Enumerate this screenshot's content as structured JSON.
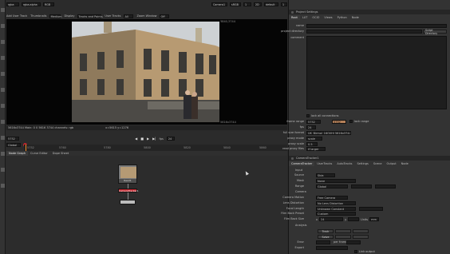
{
  "viewer": {
    "top_left": {
      "channel": "rgba",
      "layer": "rgba.alpha",
      "fmt": "RGB"
    },
    "top_right": {
      "camera": "Camera1",
      "lut": "sRGB",
      "gain": "1",
      "view": "default",
      "gamma": "1",
      "ratio": "2D",
      "zoom": "1:1"
    },
    "row2": {
      "add_user_track": "Add User Track",
      "thumbnail_label": "Thumbnails",
      "thumbnail_value": "Medium",
      "display_label": "Display",
      "display_value": "Tracks and Points",
      "user_tracks_label": "User Tracks",
      "user_tracks_value": "All",
      "zoom_label": "Zoom Window",
      "zoom_value": "Off"
    },
    "image_corner_top": "3840,3744",
    "info_bar": "5616x3744 Main: 0 0 5616 3744  channels: rgb",
    "coords": "x=5615 y=1276",
    "corner_label": "5616x3744"
  },
  "timeline": {
    "frame": "5752",
    "fps_label": "fps",
    "fps": "24",
    "mode": "Global",
    "start": "5752",
    "ticks": [
      "5752",
      "5760",
      "5780",
      "5800",
      "5820",
      "5840",
      "5860",
      "5870"
    ],
    "end": "5870"
  },
  "node_graph": {
    "tabs": [
      "Node Graph",
      "Curve Editor",
      "Dope Sheet"
    ],
    "read_label": "Read1",
    "tracker_label": "CameraTracker1"
  },
  "project_settings": {
    "title": "Project Settings",
    "tabs": [
      "Root",
      "LUT",
      "OCIO",
      "Views",
      "Python",
      "Node"
    ],
    "fields": {
      "name": "name",
      "project_directory": "project directory",
      "comment": "comment",
      "lock": "lock all connections",
      "frame_range": "frame range",
      "range_start": "5752",
      "range_end": "5752",
      "lock_range": "lock range",
      "fps": "fps",
      "fps_value": "24",
      "full_size_format": "full size format",
      "format_value": "UK_Birmol_16OVHI 5616x3744 2048x1556",
      "proxy_mode": "proxy mode",
      "proxy_mode_value": "scale",
      "proxy_scale": "proxy scale",
      "proxy_scale_value": "0.5",
      "read_proxy": "read proxy files",
      "read_proxy_value": "if larger",
      "script_directory": "Script Directory"
    }
  },
  "camera_tracker": {
    "title": "CameraTracker1",
    "tabs": [
      "CameraTracker",
      "UserTracks",
      "AutoTracks",
      "Settings",
      "Scene",
      "Output",
      "Node"
    ],
    "input_header": "Input",
    "source": "Source",
    "source_value": "Sbla",
    "mask": "Mask",
    "mask_value": "None",
    "range": "Range",
    "range_value": "Global",
    "camera_header": "Camera",
    "camera_motion": "Camera Motion",
    "camera_motion_value": "Free Camera",
    "lens_distortion": "Lens Distortion",
    "lens_distortion_value": "No Lens Distortion",
    "focal_length": "Focal Length",
    "focal_length_value": "Unknown Constant",
    "film_back_preset": "Film Back Preset",
    "film_back_value": "Custom",
    "film_back_size": "Film Back Size",
    "fb_x": "x",
    "fb_x_value": "24",
    "fb_y": "y",
    "fb_units": "Units",
    "fb_units_value": "mm",
    "analysis_header": "Analysis",
    "track": "Track",
    "solve": "Solve",
    "error": "Error",
    "per_frame": "per frame",
    "export": "Export",
    "link_output": "Link output"
  },
  "colors": {
    "bg": "#2b2b2b",
    "panel": "#393939",
    "header": "#1e1e1e",
    "accent": "#f48a24",
    "red": "#c2262e"
  }
}
